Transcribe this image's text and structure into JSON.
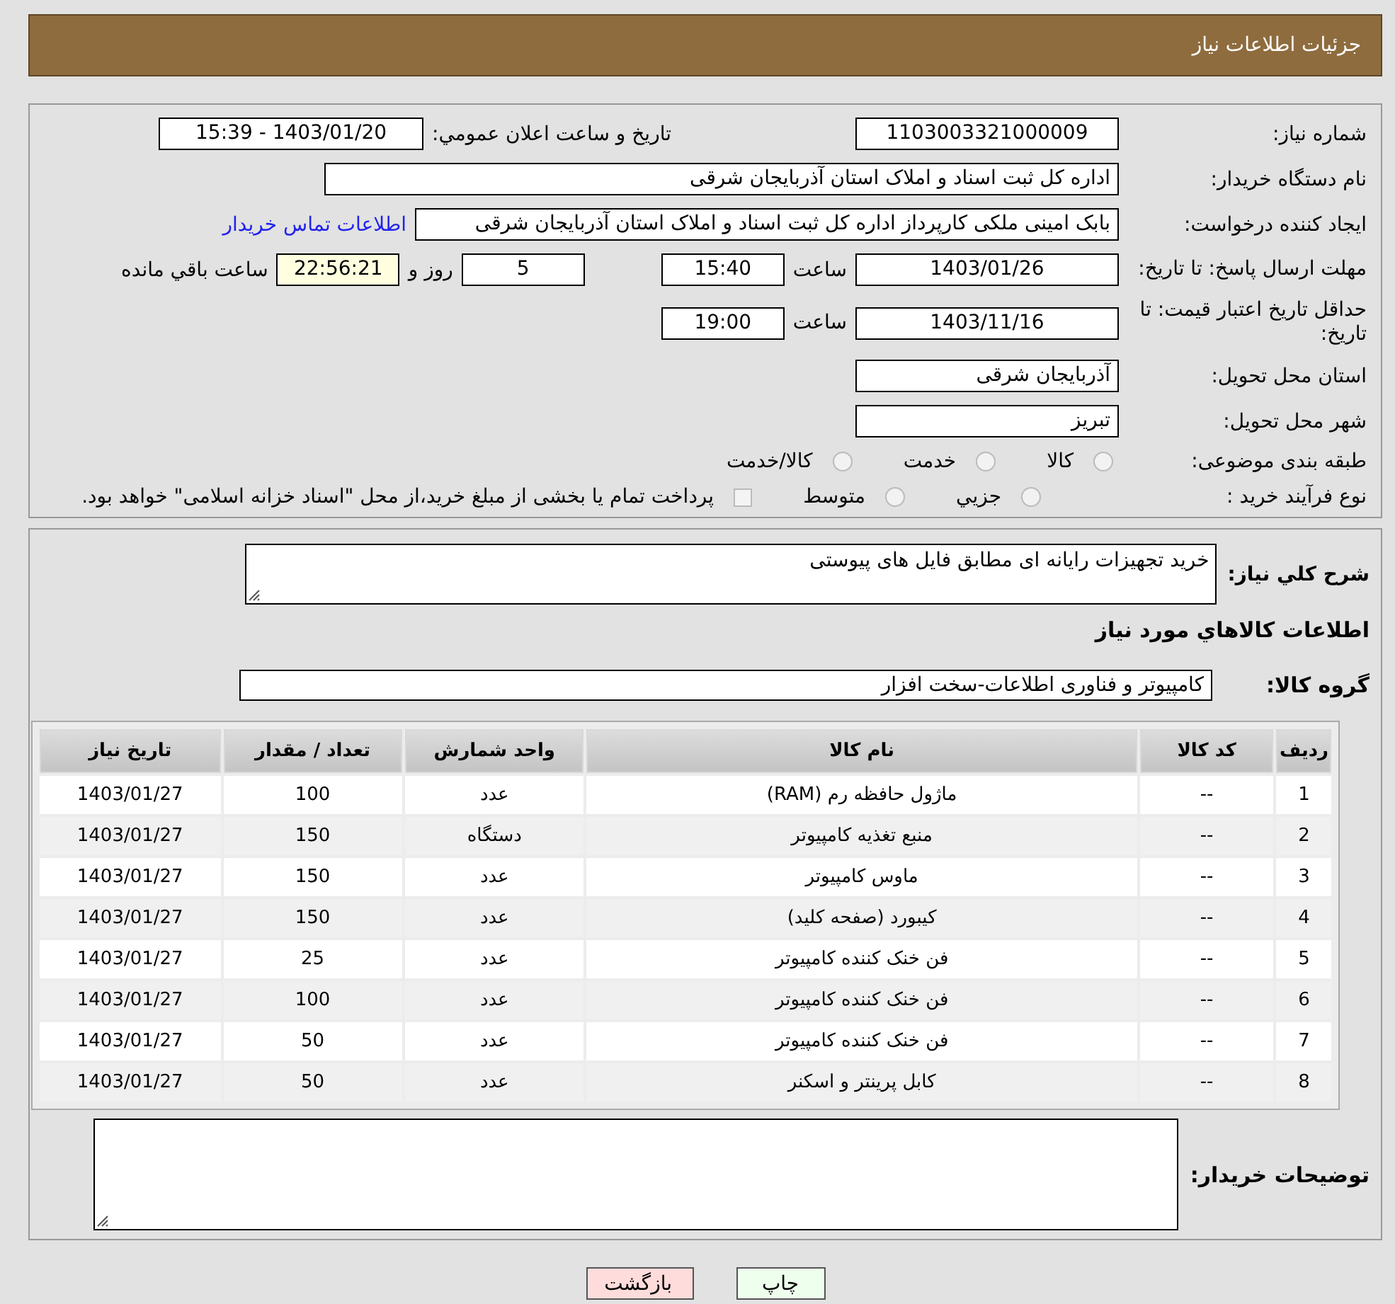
{
  "header": {
    "title": "جزئیات اطلاعات نیاز"
  },
  "details": {
    "need_number": {
      "label": "شماره نیاز:",
      "value": "1103003321000009"
    },
    "announce": {
      "label": "تاریخ و ساعت اعلان عمومي:",
      "value": "1403/01/20 - 15:39"
    },
    "buyer": {
      "label": "نام دستگاه خریدار:",
      "value": "اداره کل ثبت اسناد و املاک استان آذربایجان شرقی"
    },
    "requester": {
      "label": "ایجاد کننده درخواست:",
      "value": "بابک امینی ملکی کارپرداز اداره کل ثبت اسناد و املاک استان آذربایجان شرقی",
      "link": "اطلاعات تماس خریدار"
    },
    "response_deadline": {
      "label": "مهلت ارسال پاسخ: تا تاریخ:",
      "date": "1403/01/26",
      "time_label": "ساعت",
      "time": "15:40",
      "days": "5",
      "days_label": "روز و",
      "remaining": "22:56:21",
      "remaining_label": "ساعت باقي مانده"
    },
    "price_validity": {
      "label": "حداقل تاریخ اعتبار قیمت: تا تاریخ:",
      "date": "1403/11/16",
      "time_label": "ساعت",
      "time": "19:00"
    },
    "province": {
      "label": "استان محل تحویل:",
      "value": "آذربایجان شرقی"
    },
    "city": {
      "label": "شهر محل تحویل:",
      "value": "تبریز"
    },
    "category": {
      "label": "طبقه بندی موضوعی:",
      "options": [
        {
          "label": "کالا",
          "selected": false
        },
        {
          "label": "خدمت",
          "selected": false
        },
        {
          "label": "کالا/خدمت",
          "selected": false
        }
      ]
    },
    "process": {
      "label": "نوع فرآیند خرید :",
      "options": [
        {
          "label": "جزيي",
          "selected": false
        },
        {
          "label": "متوسط",
          "selected": false
        }
      ],
      "treasury": {
        "label": "پرداخت تمام یا بخشی از مبلغ خرید،از محل \"اسناد خزانه اسلامی\" خواهد بود.",
        "checked": false
      }
    }
  },
  "description": {
    "label": "شرح کلي نیاز:",
    "value": "خرید تجهیزات رایانه ای مطابق فایل های پیوستی"
  },
  "items_title": "اطلاعات کالاهاي مورد نیاز",
  "group": {
    "label": "گروه کالا:",
    "value": "کامپیوتر و فناوری اطلاعات-سخت افزار"
  },
  "table": {
    "columns": [
      "ردیف",
      "کد کالا",
      "نام کالا",
      "واحد شمارش",
      "تعداد / مقدار",
      "تاریخ نیاز"
    ],
    "rows": [
      [
        "1",
        "--",
        "ماژول حافظه رم (RAM)",
        "عدد",
        "100",
        "1403/01/27"
      ],
      [
        "2",
        "--",
        "منبع تغذیه کامپیوتر",
        "دستگاه",
        "150",
        "1403/01/27"
      ],
      [
        "3",
        "--",
        "ماوس کامپیوتر",
        "عدد",
        "150",
        "1403/01/27"
      ],
      [
        "4",
        "--",
        "کیبورد (صفحه کلید)",
        "عدد",
        "150",
        "1403/01/27"
      ],
      [
        "5",
        "--",
        "فن خنک کننده کامپیوتر",
        "عدد",
        "25",
        "1403/01/27"
      ],
      [
        "6",
        "--",
        "فن خنک کننده کامپیوتر",
        "عدد",
        "100",
        "1403/01/27"
      ],
      [
        "7",
        "--",
        "فن خنک کننده کامپیوتر",
        "عدد",
        "50",
        "1403/01/27"
      ],
      [
        "8",
        "--",
        "کابل پرینتر و اسکنر",
        "عدد",
        "50",
        "1403/01/27"
      ]
    ]
  },
  "notes": {
    "label": "توضیحات خریدار:"
  },
  "buttons": [
    {
      "label": "چاپ",
      "kind": "print"
    },
    {
      "label": "بازگشت",
      "kind": "back"
    }
  ]
}
